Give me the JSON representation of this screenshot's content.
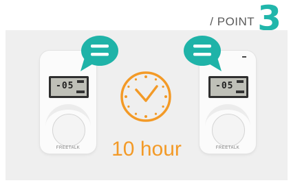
{
  "header": {
    "label": "/ POINT",
    "number": "3"
  },
  "devices": [
    {
      "lcd_text": "-05",
      "brand": "FREETALK"
    },
    {
      "lcd_text": "-05",
      "brand": "FREETALK"
    }
  ],
  "clock": {
    "caption": "10 hour",
    "icon": "clock-icon",
    "color": "#f39a27"
  },
  "bubbles": {
    "icon": "speech-bubble-icon",
    "color": "#1fb3a8"
  }
}
